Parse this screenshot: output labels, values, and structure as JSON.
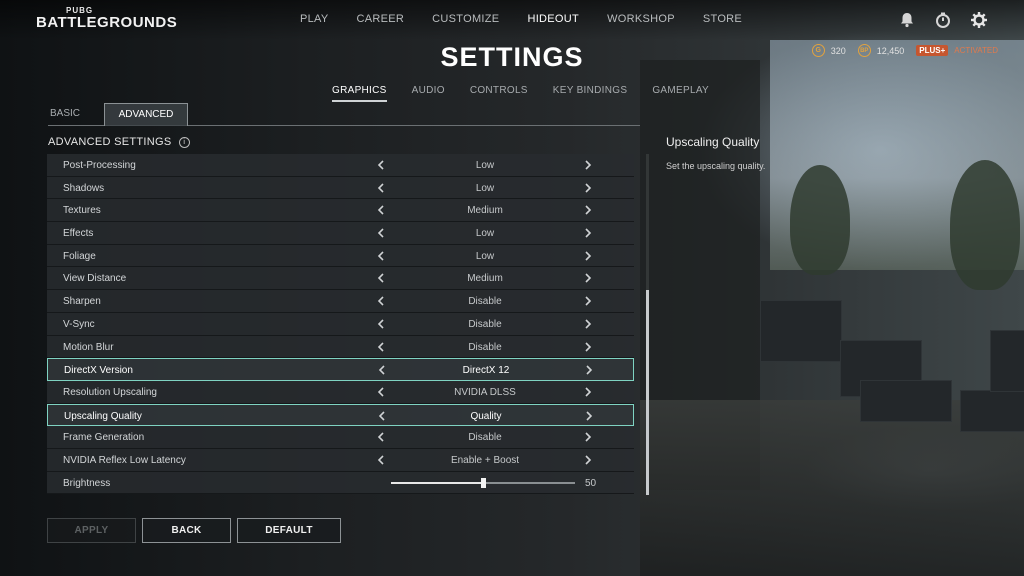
{
  "header": {
    "logo_small": "PUBG",
    "logo_big": "BATTLEGROUNDS",
    "nav": [
      "PLAY",
      "CAREER",
      "CUSTOMIZE",
      "HIDEOUT",
      "WORKSHOP",
      "STORE"
    ],
    "nav_active": "HIDEOUT",
    "icons": [
      "bell-icon",
      "stopwatch-icon",
      "gear-icon"
    ]
  },
  "currency": {
    "g_coin_symbol": "G",
    "g_coin": "320",
    "bp_symbol": "BP",
    "bp": "12,450",
    "plus_label": "PLUS+",
    "plus_status": "ACTIVATED"
  },
  "page_title": "SETTINGS",
  "subtabs": [
    "GRAPHICS",
    "AUDIO",
    "CONTROLS",
    "KEY BINDINGS",
    "GAMEPLAY"
  ],
  "subtab_active": "GRAPHICS",
  "modetabs": {
    "basic": "BASIC",
    "advanced": "ADVANCED"
  },
  "section": {
    "title": "ADVANCED SETTINGS",
    "info_glyph": "i"
  },
  "settings": [
    {
      "label": "Post-Processing",
      "value": "Low"
    },
    {
      "label": "Shadows",
      "value": "Low"
    },
    {
      "label": "Textures",
      "value": "Medium"
    },
    {
      "label": "Effects",
      "value": "Low"
    },
    {
      "label": "Foliage",
      "value": "Low"
    },
    {
      "label": "View Distance",
      "value": "Medium"
    },
    {
      "label": "Sharpen",
      "value": "Disable"
    },
    {
      "label": "V-Sync",
      "value": "Disable"
    },
    {
      "label": "Motion Blur",
      "value": "Disable"
    },
    {
      "label": "DirectX Version",
      "value": "DirectX 12"
    },
    {
      "label": "Resolution Upscaling",
      "value": "NVIDIA DLSS"
    },
    {
      "label": "Upscaling Quality",
      "value": "Quality"
    },
    {
      "label": "Frame Generation",
      "value": "Disable"
    },
    {
      "label": "NVIDIA Reflex Low Latency",
      "value": "Enable + Boost"
    },
    {
      "label": "Brightness",
      "value": "50"
    }
  ],
  "brightness_fraction": 0.5,
  "detail": {
    "title": "Upscaling Quality",
    "description": "Set the upscaling quality."
  },
  "buttons": {
    "apply": "APPLY",
    "back": "BACK",
    "default": "DEFAULT"
  },
  "colors": {
    "highlight": "#7fd3c2",
    "plus": "#c6562f",
    "coin": "#e1a23f"
  }
}
